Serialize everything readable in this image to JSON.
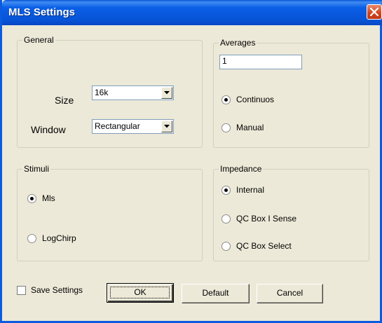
{
  "window": {
    "title": "MLS Settings",
    "close_icon": "close-icon"
  },
  "general": {
    "group_label": "General",
    "size_label": "Size",
    "size_value": "16k",
    "window_label": "Window",
    "window_value": "Rectangular"
  },
  "averages": {
    "group_label": "Averages",
    "value": "1",
    "options": [
      "Continuos",
      "Manual"
    ],
    "selected": "Continuos"
  },
  "stimuli": {
    "group_label": "Stimuli",
    "options": [
      "Mls",
      "LogChirp"
    ],
    "selected": "Mls"
  },
  "impedance": {
    "group_label": "Impedance",
    "options": [
      "Internal",
      "QC Box I Sense",
      "QC Box Select"
    ],
    "selected": "Internal"
  },
  "footer": {
    "save_settings_label": "Save Settings",
    "save_settings_checked": false,
    "ok_label": "OK",
    "default_label": "Default",
    "cancel_label": "Cancel"
  },
  "colors": {
    "title_bar": "#0a5be0",
    "dialog_bg": "#ece9d8",
    "close_button": "#d2421c"
  }
}
